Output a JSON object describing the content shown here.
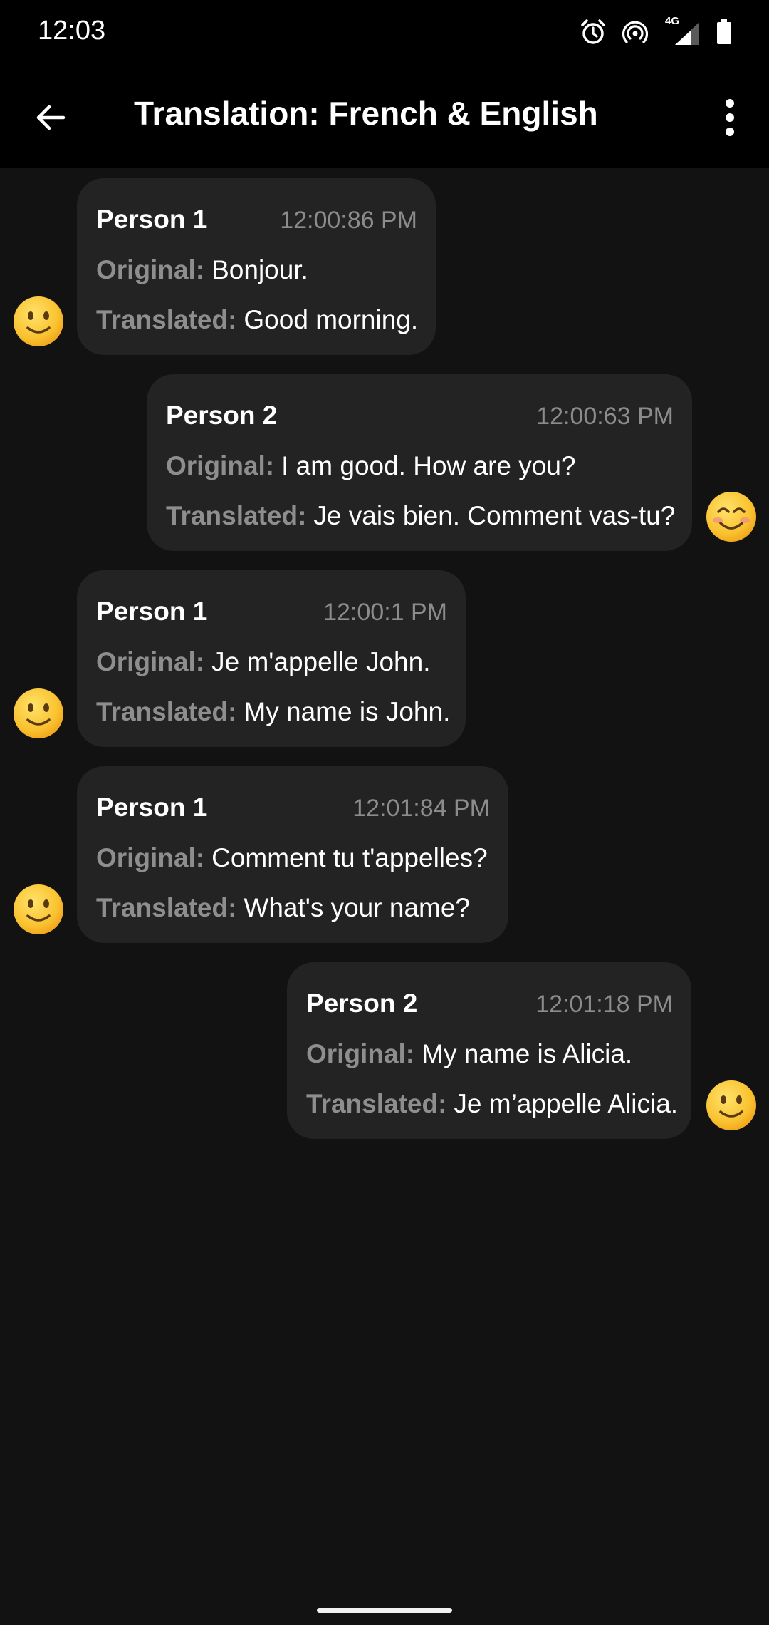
{
  "status_bar": {
    "time": "12:03",
    "icons": [
      "alarm-icon",
      "hotspot-icon",
      "4g-signal-icon",
      "battery-icon"
    ],
    "network_label": "4G"
  },
  "app_bar": {
    "back_icon": "arrow-left-icon",
    "title": "Translation: French & English",
    "menu_icon": "more-vertical-icon"
  },
  "labels": {
    "original": "Original:",
    "translated": "Translated:"
  },
  "messages": [
    {
      "sender": "Person 1",
      "time": "12:00:86 PM",
      "original": "Bonjour.",
      "translated": "Good morning.",
      "side": "left",
      "avatar": "slightly-smiling-face-emoji"
    },
    {
      "sender": "Person 2",
      "time": "12:00:63 PM",
      "original": "I am good. How are you?",
      "translated": "Je vais bien. Comment vas-tu?",
      "side": "right",
      "avatar": "smiling-face-with-smiling-eyes-emoji"
    },
    {
      "sender": "Person 1",
      "time": "12:00:1 PM",
      "original": "Je m'appelle John.",
      "translated": "My name is John.",
      "side": "left",
      "avatar": "slightly-smiling-face-emoji"
    },
    {
      "sender": "Person 1",
      "time": "12:01:84 PM",
      "original": "Comment tu t'appelles?",
      "translated": "What's your name?",
      "side": "left",
      "avatar": "slightly-smiling-face-emoji"
    },
    {
      "sender": "Person 2",
      "time": "12:01:18 PM",
      "original": "My name is Alicia.",
      "translated": "Je m’appelle Alicia.",
      "side": "right",
      "avatar": "slightly-smiling-face-emoji"
    }
  ],
  "colors": {
    "background": "#121212",
    "bar": "#000000",
    "bubble": "#232323",
    "label_gray": "#8e8e8e",
    "emoji_yellow": "#f7b728"
  }
}
